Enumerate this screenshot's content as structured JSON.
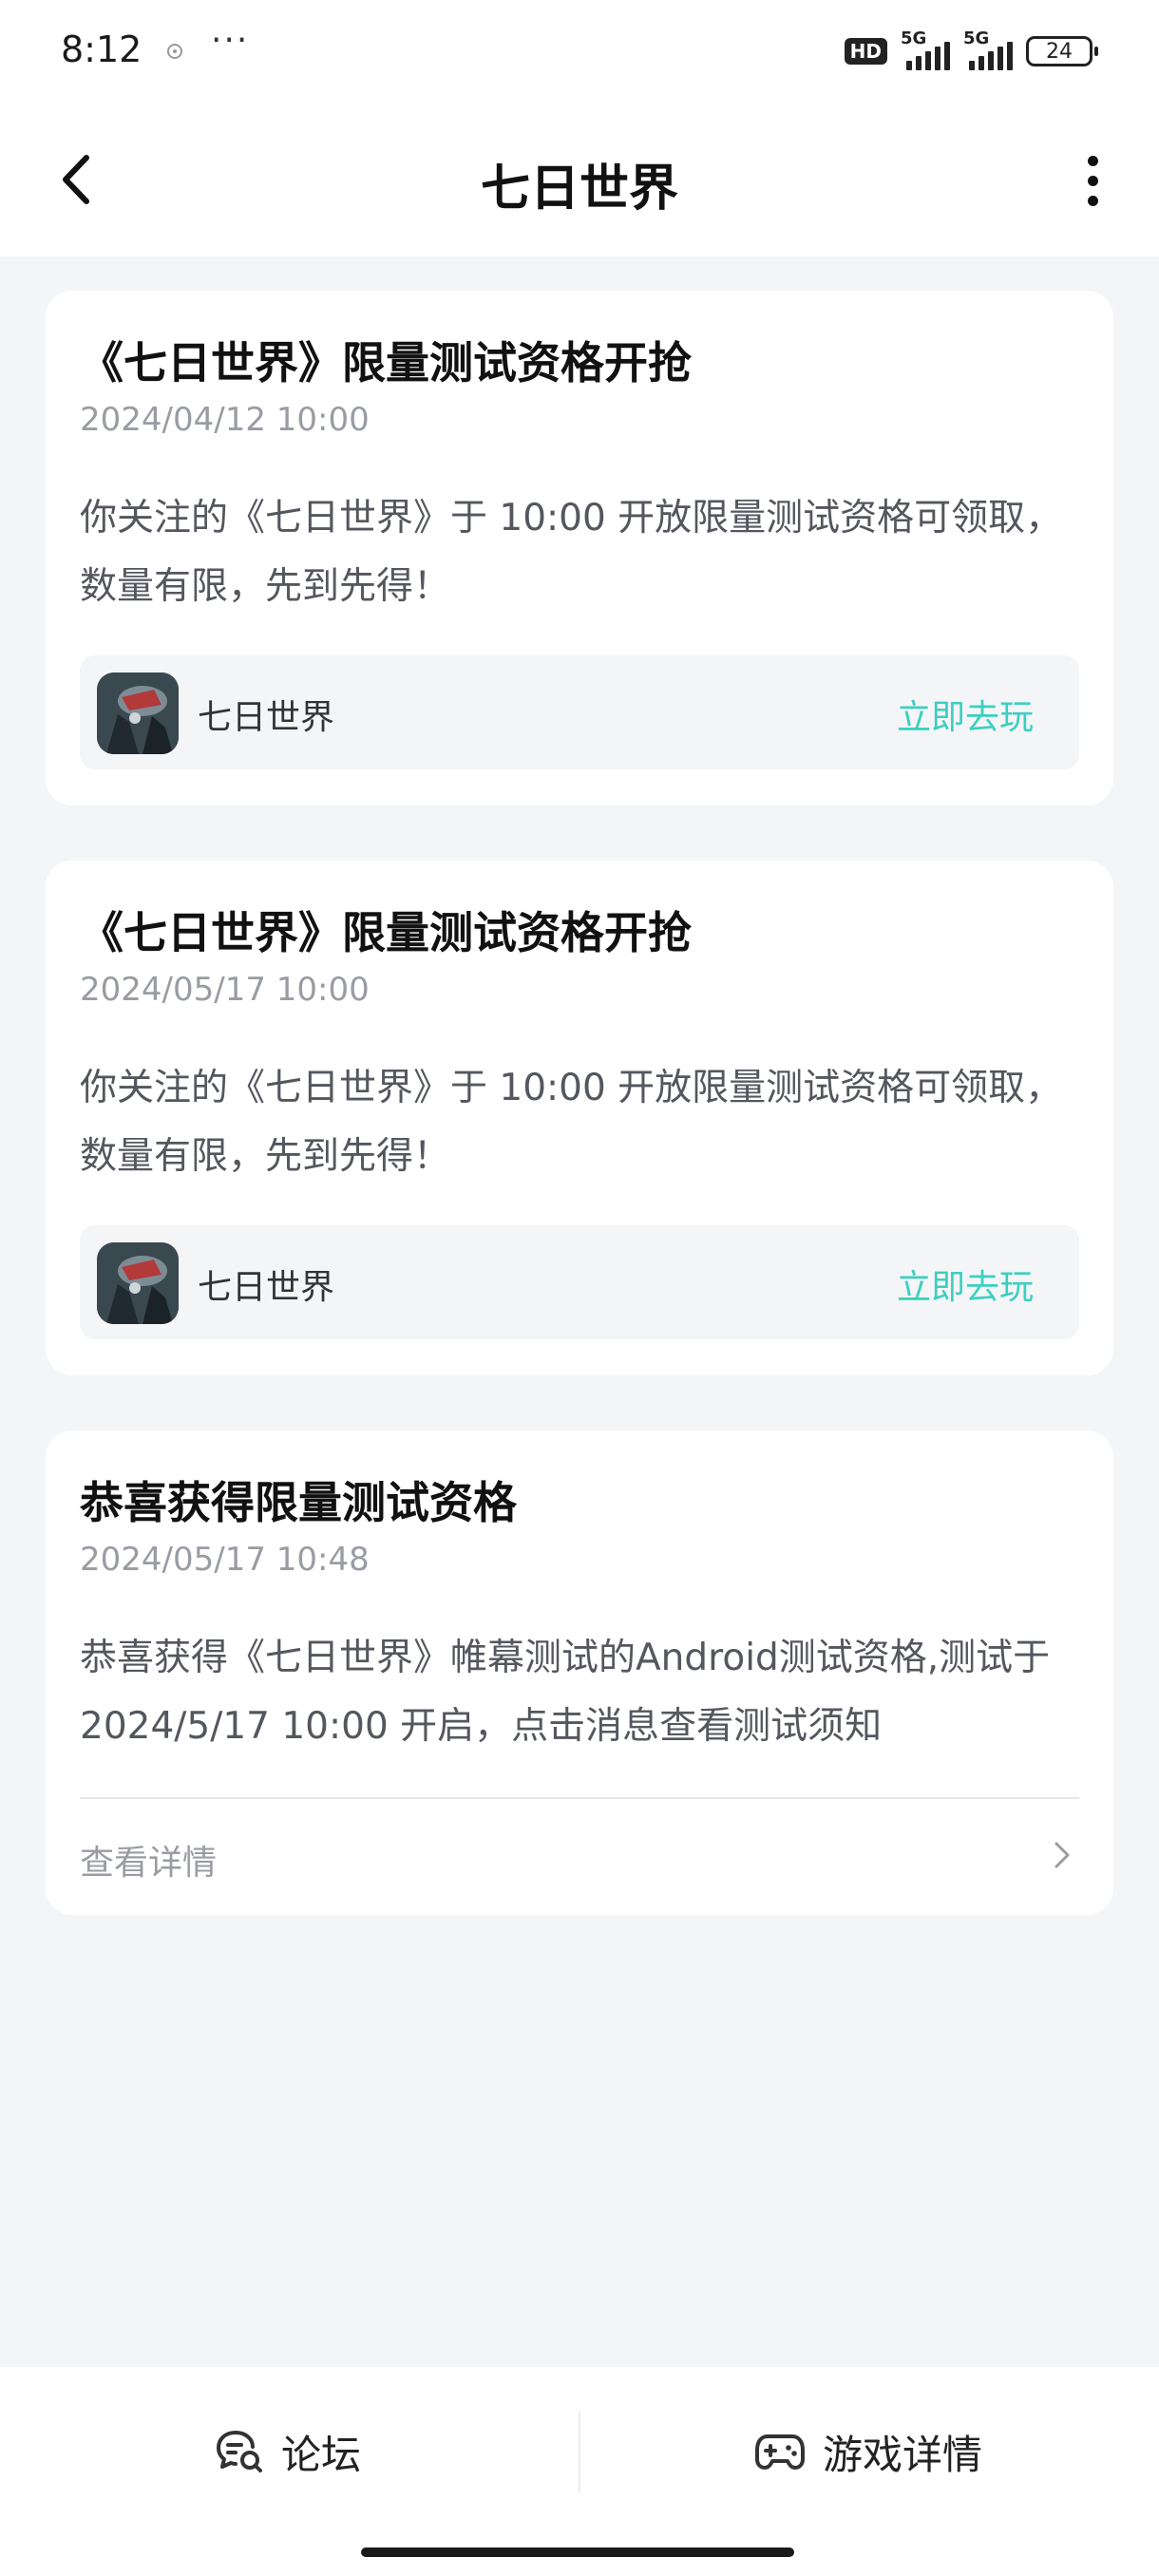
{
  "status_bar": {
    "time": "8:12",
    "more": "···",
    "hd_label": "HD",
    "network_1": "5G",
    "network_2": "5G",
    "battery": "24"
  },
  "header": {
    "title": "七日世界"
  },
  "cards": [
    {
      "title": "《七日世界》限量测试资格开抢",
      "time": "2024/04/12 10:00",
      "body": "你关注的《七日世界》于 10:00 开放限量测试资格可领取，数量有限，先到先得！",
      "game_name": "七日世界",
      "action": "立即去玩"
    },
    {
      "title": "《七日世界》限量测试资格开抢",
      "time": "2024/05/17 10:00",
      "body": "你关注的《七日世界》于 10:00 开放限量测试资格可领取，数量有限，先到先得！",
      "game_name": "七日世界",
      "action": "立即去玩"
    },
    {
      "title": "恭喜获得限量测试资格",
      "time": "2024/05/17 10:48",
      "body": "恭喜获得《七日世界》帷幕测试的Android测试资格,测试于 2024/5/17 10:00 开启，点击消息查看测试须知",
      "link": "查看详情"
    }
  ],
  "bottom_bar": {
    "forum": "论坛",
    "game_detail": "游戏详情"
  },
  "colors": {
    "accent": "#3ccfc0",
    "background": "#f4f5f7"
  }
}
